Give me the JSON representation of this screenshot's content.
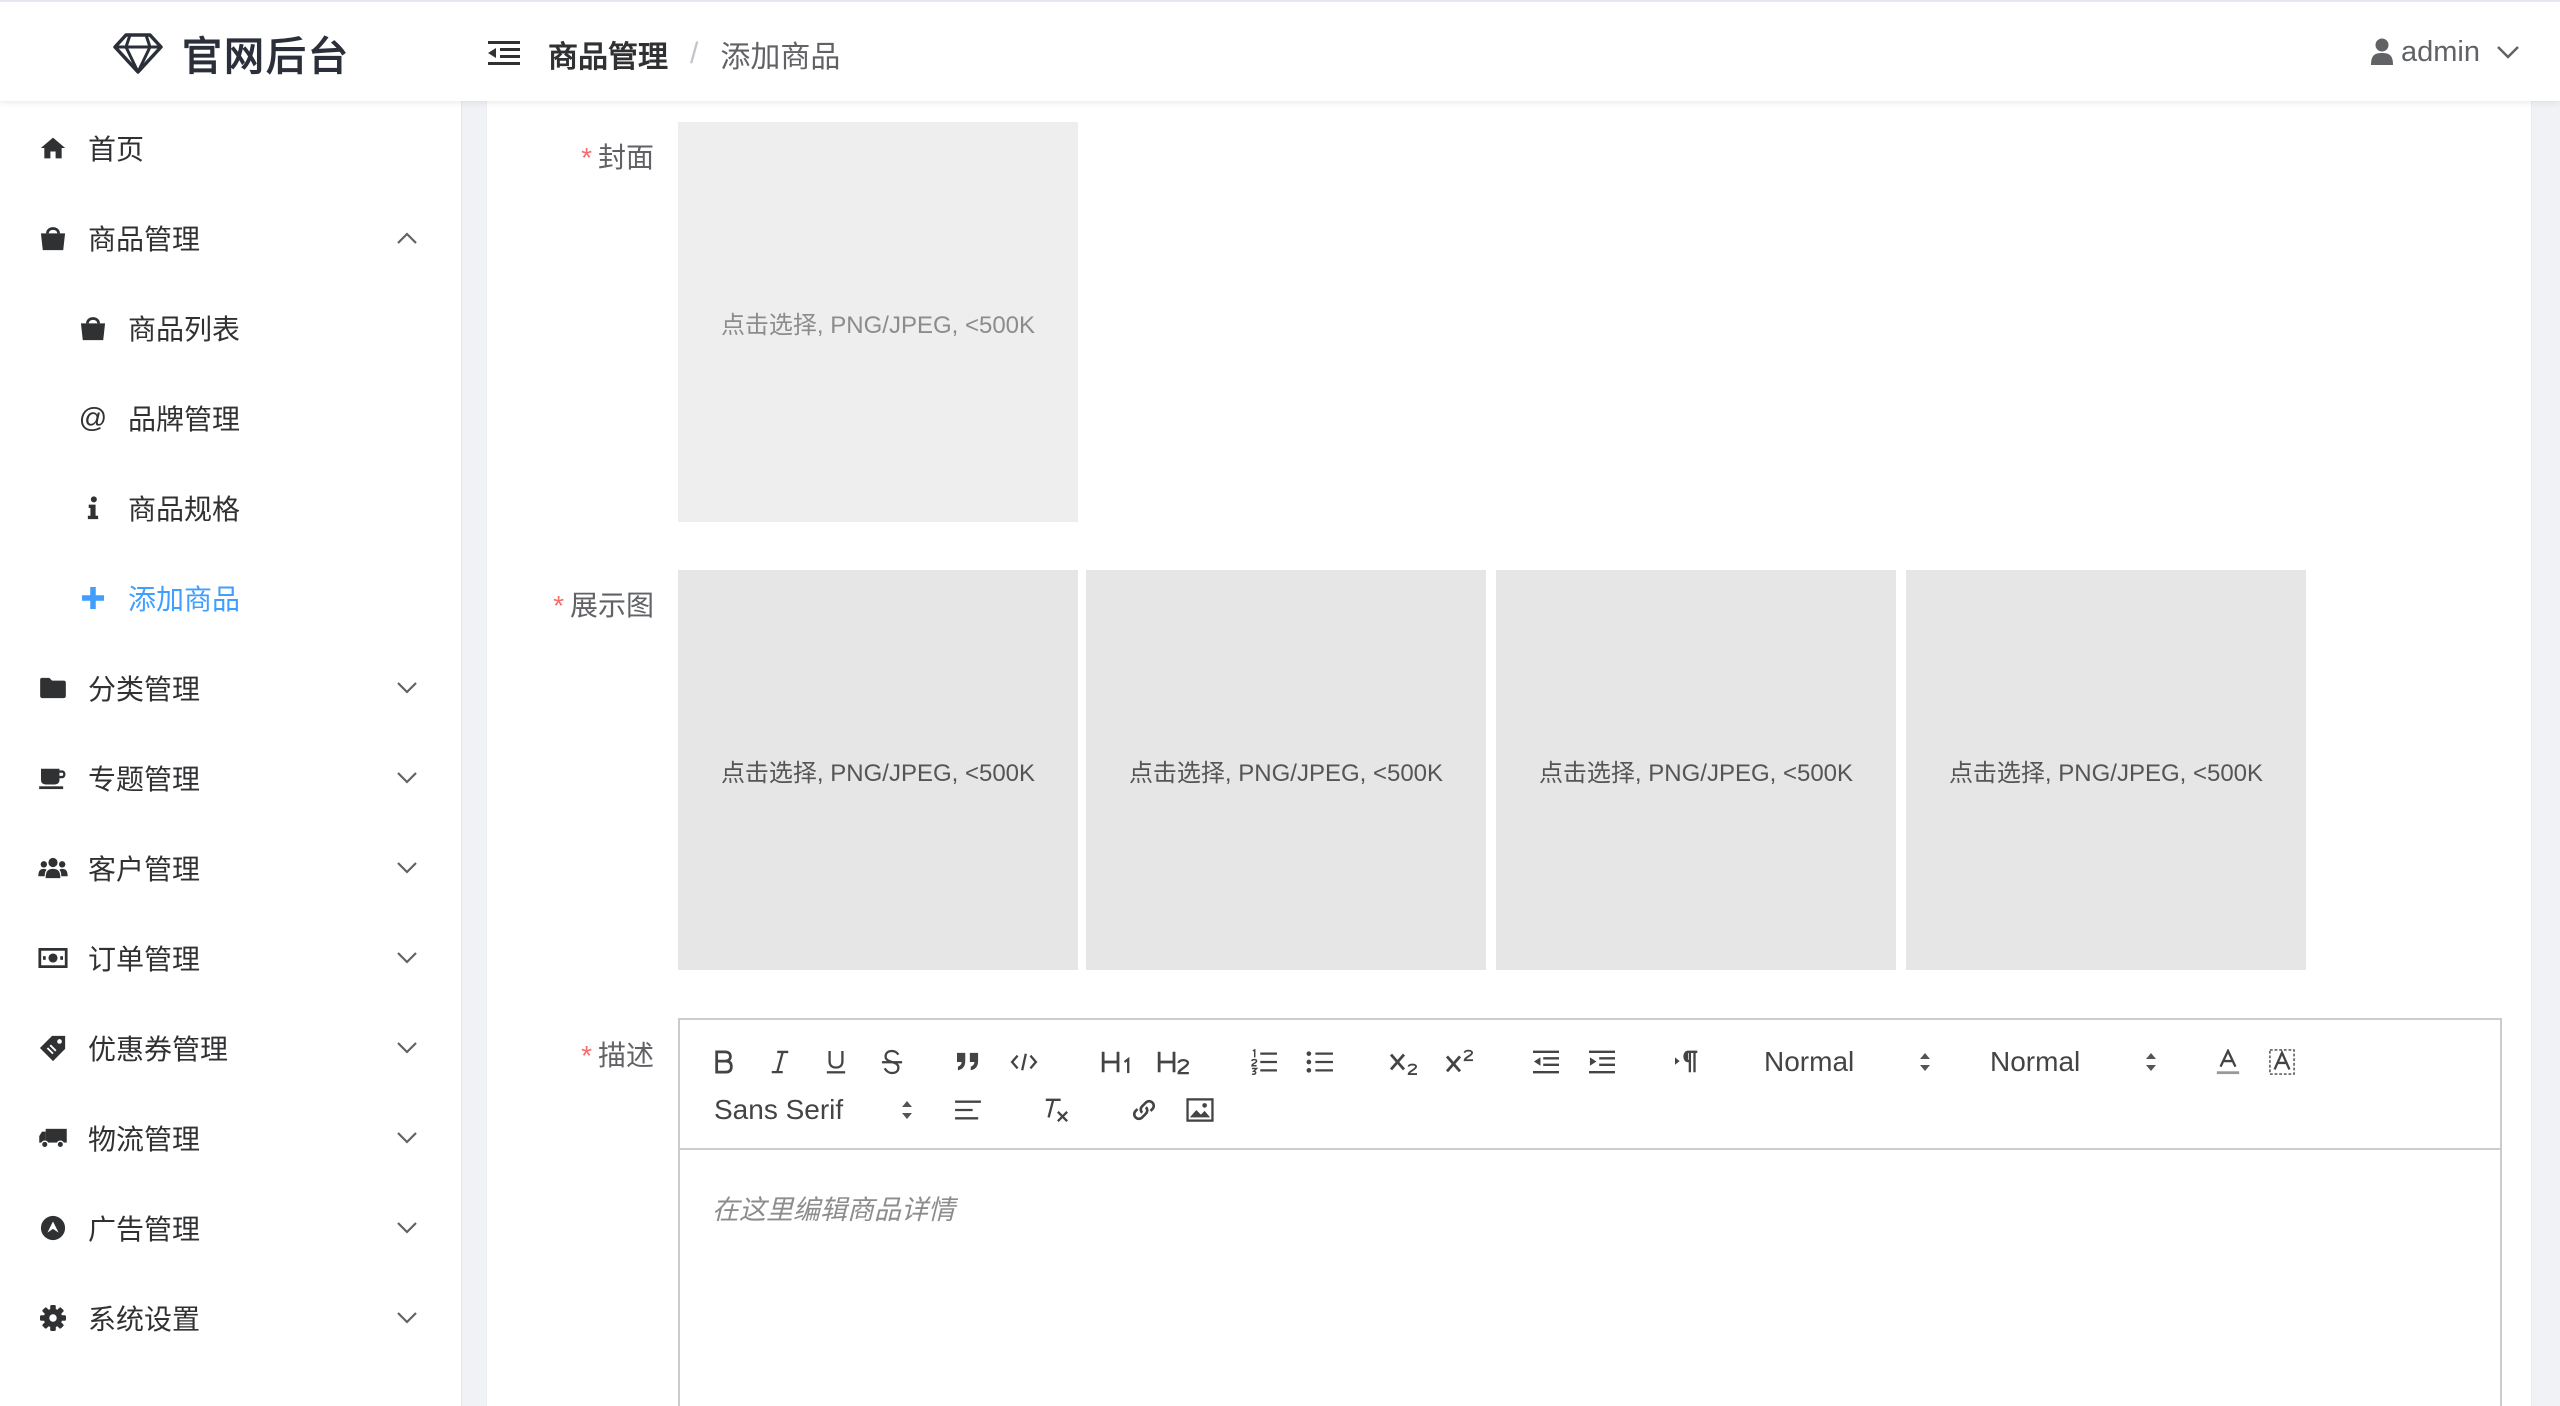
{
  "app": {
    "title": "官网后台"
  },
  "header": {
    "breadcrumb": [
      "商品管理",
      "添加商品"
    ],
    "breadcrumb_sep": "/",
    "user": "admin"
  },
  "sidebar": {
    "items": [
      {
        "label": "首页",
        "icon": "home-icon"
      },
      {
        "label": "商品管理",
        "icon": "shopping-bag-icon",
        "expanded": true
      },
      {
        "label": "商品列表",
        "icon": "shopping-bag-icon",
        "sub": true
      },
      {
        "label": "品牌管理",
        "icon": "at-icon",
        "sub": true
      },
      {
        "label": "商品规格",
        "icon": "info-icon",
        "sub": true
      },
      {
        "label": "添加商品",
        "icon": "plus-icon",
        "sub": true,
        "active": true
      },
      {
        "label": "分类管理",
        "icon": "folder-icon"
      },
      {
        "label": "专题管理",
        "icon": "coffee-icon"
      },
      {
        "label": "客户管理",
        "icon": "users-icon"
      },
      {
        "label": "订单管理",
        "icon": "money-icon"
      },
      {
        "label": "优惠券管理",
        "icon": "ticket-icon"
      },
      {
        "label": "物流管理",
        "icon": "truck-icon"
      },
      {
        "label": "广告管理",
        "icon": "compass-icon"
      },
      {
        "label": "系统设置",
        "icon": "gear-icon"
      }
    ]
  },
  "form": {
    "required_mark": "*",
    "cover_label": "封面",
    "gallery_label": "展示图",
    "desc_label": "描述",
    "upload_hint": "点击选择, PNG/JPEG, <500K",
    "gallery_hints": [
      "点击选择, PNG/JPEG, <500K",
      "点击选择, PNG/JPEG, <500K",
      "点击选择, PNG/JPEG, <500K",
      "点击选择, PNG/JPEG, <500K"
    ]
  },
  "editor": {
    "header_select": "Normal",
    "size_select": "Normal",
    "font_select": "Sans Serif",
    "placeholder": "在这里编辑商品详情"
  },
  "colors": {
    "accent": "#409eff",
    "required": "#f56c6c",
    "upload_bg": "#e6e6e6"
  }
}
